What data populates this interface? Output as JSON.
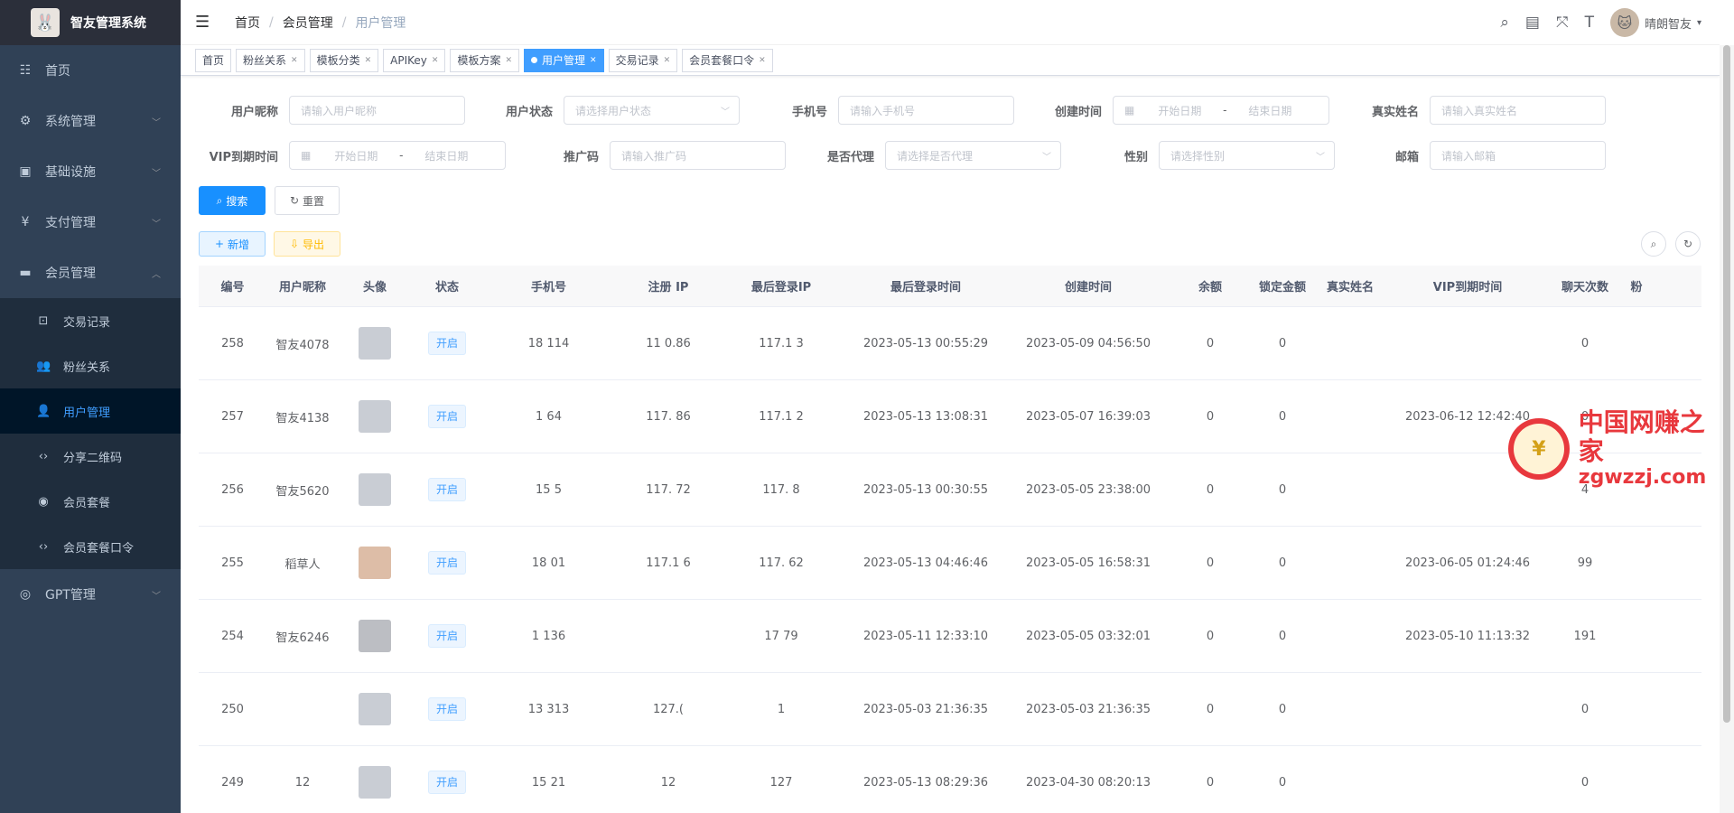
{
  "app": {
    "title": "智友管理系统"
  },
  "sidebar": {
    "items": [
      {
        "label": "首页",
        "icon": "dashboard-icon"
      },
      {
        "label": "系统管理",
        "icon": "gear-icon"
      },
      {
        "label": "基础设施",
        "icon": "monitor-icon"
      },
      {
        "label": "支付管理",
        "icon": "yen-icon"
      },
      {
        "label": "会员管理",
        "icon": "card-icon"
      }
    ],
    "sub_items": [
      {
        "label": "交易记录",
        "icon": "record-icon"
      },
      {
        "label": "粉丝关系",
        "icon": "people-icon"
      },
      {
        "label": "用户管理",
        "icon": "user-icon"
      },
      {
        "label": "分享二维码",
        "icon": "code-icon"
      },
      {
        "label": "会员套餐",
        "icon": "target-icon"
      },
      {
        "label": "会员套餐口令",
        "icon": "code-icon"
      }
    ],
    "gpt": {
      "label": "GPT管理",
      "icon": "gear-icon"
    }
  },
  "breadcrumb": {
    "home": "首页",
    "parent": "会员管理",
    "current": "用户管理"
  },
  "header": {
    "username": "晴朗智友"
  },
  "tags": [
    {
      "label": "首页"
    },
    {
      "label": "粉丝关系"
    },
    {
      "label": "模板分类"
    },
    {
      "label": "APIKey"
    },
    {
      "label": "模板方案"
    },
    {
      "label": "用户管理"
    },
    {
      "label": "交易记录"
    },
    {
      "label": "会员套餐口令"
    }
  ],
  "form": {
    "nickname": {
      "label": "用户昵称",
      "placeholder": "请输入用户昵称"
    },
    "status": {
      "label": "用户状态",
      "placeholder": "请选择用户状态"
    },
    "phone": {
      "label": "手机号",
      "placeholder": "请输入手机号"
    },
    "created": {
      "label": "创建时间",
      "start": "开始日期",
      "end": "结束日期",
      "sep": "-"
    },
    "realname": {
      "label": "真实姓名",
      "placeholder": "请输入真实姓名"
    },
    "vip_expire": {
      "label": "VIP到期时间",
      "start": "开始日期",
      "end": "结束日期",
      "sep": "-"
    },
    "promo": {
      "label": "推广码",
      "placeholder": "请输入推广码"
    },
    "agent": {
      "label": "是否代理",
      "placeholder": "请选择是否代理"
    },
    "gender": {
      "label": "性别",
      "placeholder": "请选择性别"
    },
    "email": {
      "label": "邮箱",
      "placeholder": "请输入邮箱"
    },
    "search_btn": "搜索",
    "reset_btn": "重置",
    "add_btn": "新增",
    "export_btn": "导出"
  },
  "table": {
    "headers": [
      "编号",
      "用户昵称",
      "头像",
      "状态",
      "手机号",
      "注册 IP",
      "最后登录IP",
      "最后登录时间",
      "创建时间",
      "余额",
      "锁定金额",
      "真实姓名",
      "VIP到期时间",
      "聊天次数",
      "粉"
    ],
    "rows": [
      {
        "id": "258",
        "nick": "智友4078",
        "avatar": "blank",
        "status": "开启",
        "phone": "18    114",
        "reg_ip": "11      0.86",
        "last_ip": "117.1         3",
        "last_login": "2023-05-13 00:55:29",
        "created": "2023-05-09 04:56:50",
        "balance": "0",
        "locked": "0",
        "realname": "",
        "vip": "",
        "chats": "0"
      },
      {
        "id": "257",
        "nick": "智友4138",
        "avatar": "blank",
        "status": "开启",
        "phone": "1       64",
        "reg_ip": "117.      86",
        "last_ip": "117.1         2",
        "last_login": "2023-05-13 13:08:31",
        "created": "2023-05-07 16:39:03",
        "balance": "0",
        "locked": "0",
        "realname": "",
        "vip": "2023-06-12 12:42:40",
        "chats": "0"
      },
      {
        "id": "256",
        "nick": "智友5620",
        "avatar": "blank",
        "status": "开启",
        "phone": "15      5",
        "reg_ip": "117.      72",
        "last_ip": "117.       8",
        "last_login": "2023-05-13 00:30:55",
        "created": "2023-05-05 23:38:00",
        "balance": "0",
        "locked": "0",
        "realname": "",
        "vip": "",
        "chats": "4"
      },
      {
        "id": "255",
        "nick": "稻草人",
        "avatar": "photo",
        "status": "开启",
        "phone": "18      01",
        "reg_ip": "117.1      6",
        "last_ip": "117.       62",
        "last_login": "2023-05-13 04:46:46",
        "created": "2023-05-05 16:58:31",
        "balance": "0",
        "locked": "0",
        "realname": "",
        "vip": "2023-06-05 01:24:46",
        "chats": "99"
      },
      {
        "id": "254",
        "nick": "智友6246",
        "avatar": "default",
        "status": "开启",
        "phone": "1      136",
        "reg_ip": "           ",
        "last_ip": "17        79",
        "last_login": "2023-05-11 12:33:10",
        "created": "2023-05-05 03:32:01",
        "balance": "0",
        "locked": "0",
        "realname": "",
        "vip": "2023-05-10 11:13:32",
        "chats": "191"
      },
      {
        "id": "250",
        "nick": "",
        "avatar": "blank",
        "status": "开启",
        "phone": "13      313",
        "reg_ip": "127.(",
        "last_ip": "1",
        "last_login": "2023-05-03 21:36:35",
        "created": "2023-05-03 21:36:35",
        "balance": "0",
        "locked": "0",
        "realname": "",
        "vip": "",
        "chats": "0"
      },
      {
        "id": "249",
        "nick": "12",
        "avatar": "blank",
        "status": "开启",
        "phone": "15      21",
        "reg_ip": "12",
        "last_ip": "127",
        "last_login": "2023-05-13 08:29:36",
        "created": "2023-04-30 08:20:13",
        "balance": "0",
        "locked": "0",
        "realname": "",
        "vip": "",
        "chats": "0"
      }
    ]
  },
  "watermark": {
    "cn": "中国网赚之家",
    "en": "zgwzzj.com"
  },
  "colors": {
    "sidebar": "#304156",
    "primary": "#1890ff",
    "active_tag": "#409eff"
  }
}
